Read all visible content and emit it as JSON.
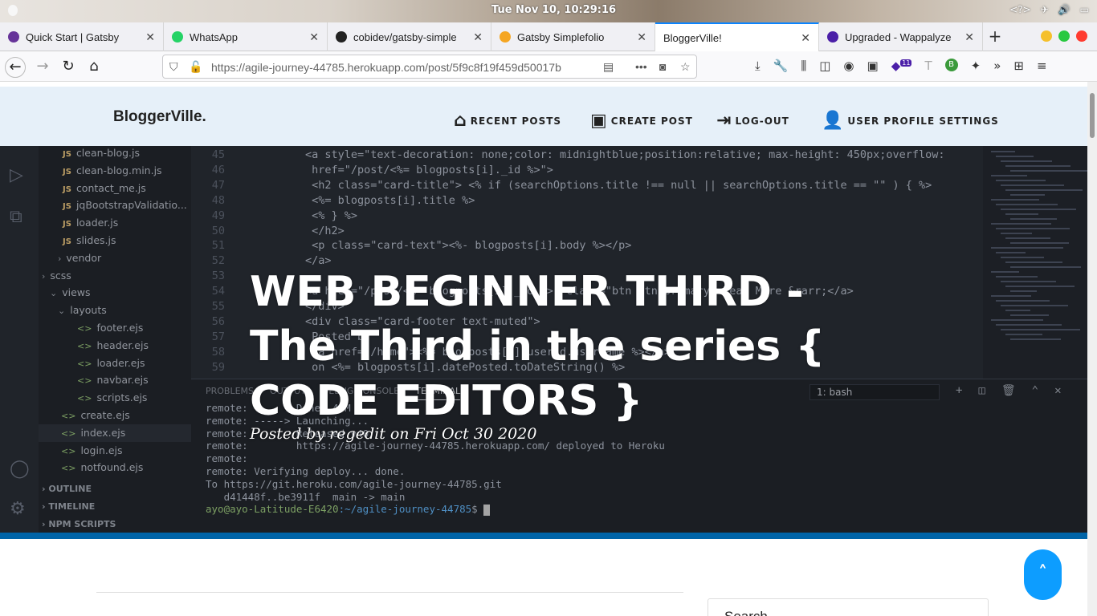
{
  "os": {
    "clock": "Tue Nov 10, 10:29:16",
    "tray_text": "<?>"
  },
  "browser": {
    "tabs": [
      {
        "label": "Quick Start | Gatsby",
        "icon_color": "#663399"
      },
      {
        "label": "WhatsApp",
        "icon_color": "#25d366"
      },
      {
        "label": "cobidev/gatsby-simple",
        "icon_color": "#222222"
      },
      {
        "label": "Gatsby Simplefolio",
        "icon_color": "#f5a623"
      },
      {
        "label": "BloggerVille!",
        "icon_color": "#ffffff"
      },
      {
        "label": "Upgraded - Wappalyze",
        "icon_color": "#4b1fa8"
      }
    ],
    "url": "https://agile-journey-44785.herokuapp.com/post/5f9c8f19f459d50017b",
    "extension_badge": "11",
    "extension_letter": "B"
  },
  "blog": {
    "brand": "BloggerVille.",
    "nav": [
      {
        "label": "RECENT POSTS",
        "icon": "home-icon"
      },
      {
        "label": "CREATE POST",
        "icon": "create-icon"
      },
      {
        "label": "LOG-OUT",
        "icon": "logout-icon"
      },
      {
        "label": "USER PROFILE SETTINGS",
        "icon": "user-secret-icon"
      }
    ],
    "post_title": "WEB BEGINNER THIRD - The Third in the series { CODE EDITORS }",
    "post_meta": "Posted by regedit on Fri Oct 30 2020",
    "sidebar_card_title": "Search"
  },
  "vscode": {
    "explorer": [
      {
        "kind": "js",
        "label": "clean-blog.js"
      },
      {
        "kind": "js",
        "label": "clean-blog.min.js"
      },
      {
        "kind": "js",
        "label": "contact_me.js"
      },
      {
        "kind": "js",
        "label": "jqBootstrapValidatio..."
      },
      {
        "kind": "js",
        "label": "loader.js"
      },
      {
        "kind": "js",
        "label": "slides.js"
      },
      {
        "kind": "folder",
        "label": "vendor"
      },
      {
        "kind": "folder",
        "label": "scss"
      },
      {
        "kind": "folder-open",
        "label": "views"
      },
      {
        "kind": "folder-open",
        "label": "layouts"
      },
      {
        "kind": "ejs",
        "label": "footer.ejs"
      },
      {
        "kind": "ejs",
        "label": "header.ejs"
      },
      {
        "kind": "ejs",
        "label": "loader.ejs"
      },
      {
        "kind": "ejs",
        "label": "navbar.ejs"
      },
      {
        "kind": "ejs",
        "label": "scripts.ejs"
      },
      {
        "kind": "ejs",
        "label": "create.ejs"
      },
      {
        "kind": "ejs",
        "label": "index.ejs"
      },
      {
        "kind": "ejs",
        "label": "login.ejs"
      },
      {
        "kind": "ejs",
        "label": "notfound.ejs"
      }
    ],
    "sections": [
      "OUTLINE",
      "TIMELINE",
      "NPM SCRIPTS"
    ],
    "code": [
      {
        "n": "45",
        "t": "<a style=\"text-decoration: none;color: midnightblue;position:relative; max-height: 450px;overflow:"
      },
      {
        "n": "46",
        "t": "  href=\"/post/<%= blogposts[i]._id %>\">"
      },
      {
        "n": "47",
        "t": "  <h2 class=\"card-title\"> <% if (searchOptions.title !== null || searchOptions.title == \"\" )  { %>"
      },
      {
        "n": "48",
        "t": "    <%= blogposts[i].title %>"
      },
      {
        "n": "49",
        "t": "    <% } %>"
      },
      {
        "n": "50",
        "t": "  </h2>"
      },
      {
        "n": "51",
        "t": "  <p class=\"card-text\"><%- blogposts[i].body %></p>"
      },
      {
        "n": "52",
        "t": "</a>"
      },
      {
        "n": "53",
        "t": ""
      },
      {
        "n": "54",
        "t": "<a href=\"/post/<%= blogposts[i]._id %>\" class=\"btn btn-primary\">Read More &rarr;</a>"
      },
      {
        "n": "55",
        "t": "</div>"
      },
      {
        "n": "56",
        "t": "<div class=\"card-footer text-muted\">"
      },
      {
        "n": "57",
        "t": "  Posted by"
      },
      {
        "n": "58",
        "t": "  <a href=\"/home\"><%= blogposts[i].userid.username %></a>"
      },
      {
        "n": "59",
        "t": "  on <%= blogposts[i].datePosted.toDateString() %>"
      }
    ],
    "panel_tabs": [
      "PROBLEMS",
      "OUTPUT",
      "DEBUG CONSOLE",
      "TERMINAL"
    ],
    "terminal_select": "1: bash",
    "terminal": [
      "remote:        Done: 45M",
      "remote: -----> Launching...",
      "remote:        Released v40",
      "remote:        https://agile-journey-44785.herokuapp.com/ deployed to Heroku",
      "remote:",
      "remote: Verifying deploy... done.",
      "To https://git.heroku.com/agile-journey-44785.git",
      "   d41448f..be3911f  main -> main"
    ],
    "prompt_user": "ayo@ayo-Latitude-E6420",
    "prompt_path": ":~/agile-journey-44785",
    "prompt_symbol": "$"
  },
  "colors": {
    "nav_bg": "#e6f0f9",
    "accent": "#0d9dff",
    "vscode_bg": "#282c34"
  }
}
